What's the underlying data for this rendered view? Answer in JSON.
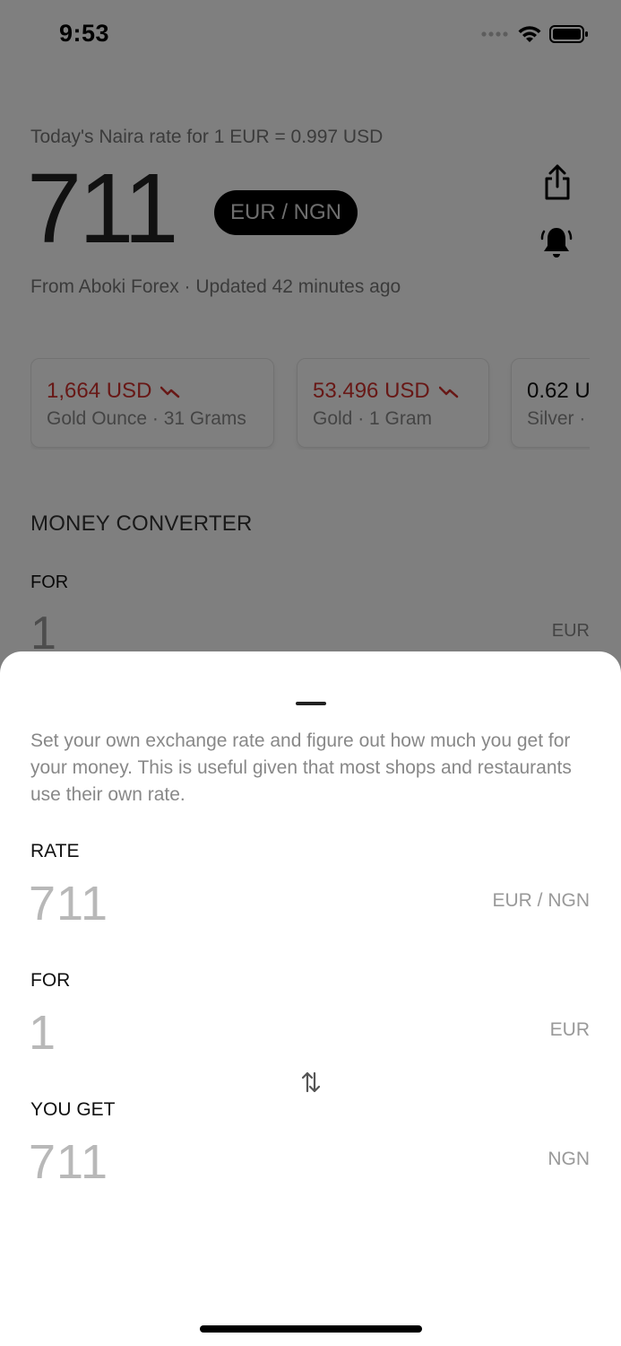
{
  "status": {
    "time": "9:53"
  },
  "header": {
    "rate_caption": "Today's Naira rate for 1 EUR = 0.997 USD",
    "rate_value": "711",
    "pair": "EUR / NGN",
    "source": "From Aboki Forex · Updated 42 minutes ago"
  },
  "metals": [
    {
      "price": "1,664 USD",
      "label": "Gold Ounce · 31 Grams",
      "trend": "down"
    },
    {
      "price": "53.496 USD",
      "label": "Gold · 1 Gram",
      "trend": "down"
    },
    {
      "price": "0.62 U",
      "label": "Silver ·",
      "trend": "none"
    }
  ],
  "converter": {
    "title": "MONEY CONVERTER",
    "for_label": "FOR",
    "for_value": "1",
    "for_currency": "EUR"
  },
  "sheet": {
    "description": "Set your own exchange rate and figure out how much you get for your money. This is useful given that most shops and restaurants use their own rate.",
    "rate_label": "RATE",
    "rate_value": "711",
    "rate_unit": "EUR / NGN",
    "for_label": "FOR",
    "for_value": "1",
    "for_unit": "EUR",
    "get_label": "YOU GET",
    "get_value": "711",
    "get_unit": "NGN"
  },
  "icons": [
    "signal-icon",
    "wifi-icon",
    "battery-icon",
    "share-icon",
    "bell-icon",
    "trend-down-icon",
    "swap-icon"
  ],
  "colors": {
    "down": "#d0312d",
    "overlay": "rgba(0,0,0,0.5)",
    "pill": "#000000"
  }
}
